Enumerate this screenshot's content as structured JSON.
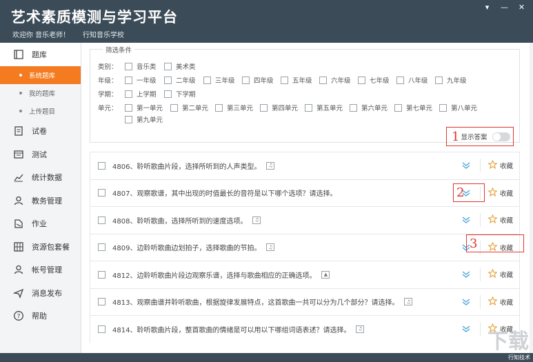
{
  "header": {
    "title": "艺术素质模测与学习平台",
    "welcome": "欢迎你 音乐老师！",
    "school": "行知音乐学校"
  },
  "sidebar": {
    "items": [
      {
        "label": "题库",
        "icon": "book-icon"
      },
      {
        "label": "试卷",
        "icon": "paper-icon"
      },
      {
        "label": "测试",
        "icon": "test-icon"
      },
      {
        "label": "统计数据",
        "icon": "chart-icon"
      },
      {
        "label": "教务管理",
        "icon": "user-icon"
      },
      {
        "label": "作业",
        "icon": "homework-icon"
      },
      {
        "label": "资源包套餐",
        "icon": "resource-icon"
      },
      {
        "label": "帐号管理",
        "icon": "account-icon"
      },
      {
        "label": "消息发布",
        "icon": "send-icon"
      },
      {
        "label": "帮助",
        "icon": "help-icon"
      }
    ],
    "subitems": [
      {
        "label": "系统题库",
        "active": true
      },
      {
        "label": "我的题库",
        "active": false
      },
      {
        "label": "上传题目",
        "active": false
      }
    ]
  },
  "filter": {
    "legend": "筛选条件",
    "rows": [
      {
        "label": "类别：",
        "options": [
          "音乐类",
          "美术类"
        ]
      },
      {
        "label": "年级：",
        "options": [
          "一年级",
          "二年级",
          "三年级",
          "四年级",
          "五年级",
          "六年级",
          "七年级",
          "八年级",
          "九年级"
        ]
      },
      {
        "label": "学期：",
        "options": [
          "上学期",
          "下学期"
        ]
      },
      {
        "label": "单元：",
        "options": [
          "第一单元",
          "第二单元",
          "第三单元",
          "第四单元",
          "第五单元",
          "第六单元",
          "第七单元",
          "第八单元"
        ]
      },
      {
        "label": "",
        "options": [
          "第九单元"
        ]
      }
    ],
    "show_answer_label": "显示答案",
    "show_answer_on": false
  },
  "markers": {
    "m1": "1",
    "m2": "2",
    "m3": "3"
  },
  "questions": [
    {
      "text": "4806、聆听歌曲片段，选择所听到的人声类型。",
      "media": "music-icon"
    },
    {
      "text": "4807、观察歌谱，其中出现的时值最长的音符是以下哪个选项？请选择。",
      "media": ""
    },
    {
      "text": "4808、聆听歌曲，选择所听到的速度选项。",
      "media": "music-icon"
    },
    {
      "text": "4809、边聆听歌曲边划拍子，选择歌曲的节拍。",
      "media": "music-icon"
    },
    {
      "text": "4812、边聆听歌曲片段边观察乐谱，选择与歌曲相应的正确选项。",
      "media": "image-icon"
    },
    {
      "text": "4813、观察曲谱并聆听歌曲，根据旋律发展特点，这首歌曲一共可以分为几个部分？请选择。",
      "media": "music-icon"
    },
    {
      "text": "4814、聆听歌曲片段，整首歌曲的情绪是可以用以下哪组词语表述？请选择。",
      "media": "music-icon"
    }
  ],
  "fav_label": "收藏",
  "watermark": "下载",
  "watermark_site": "行知技术"
}
